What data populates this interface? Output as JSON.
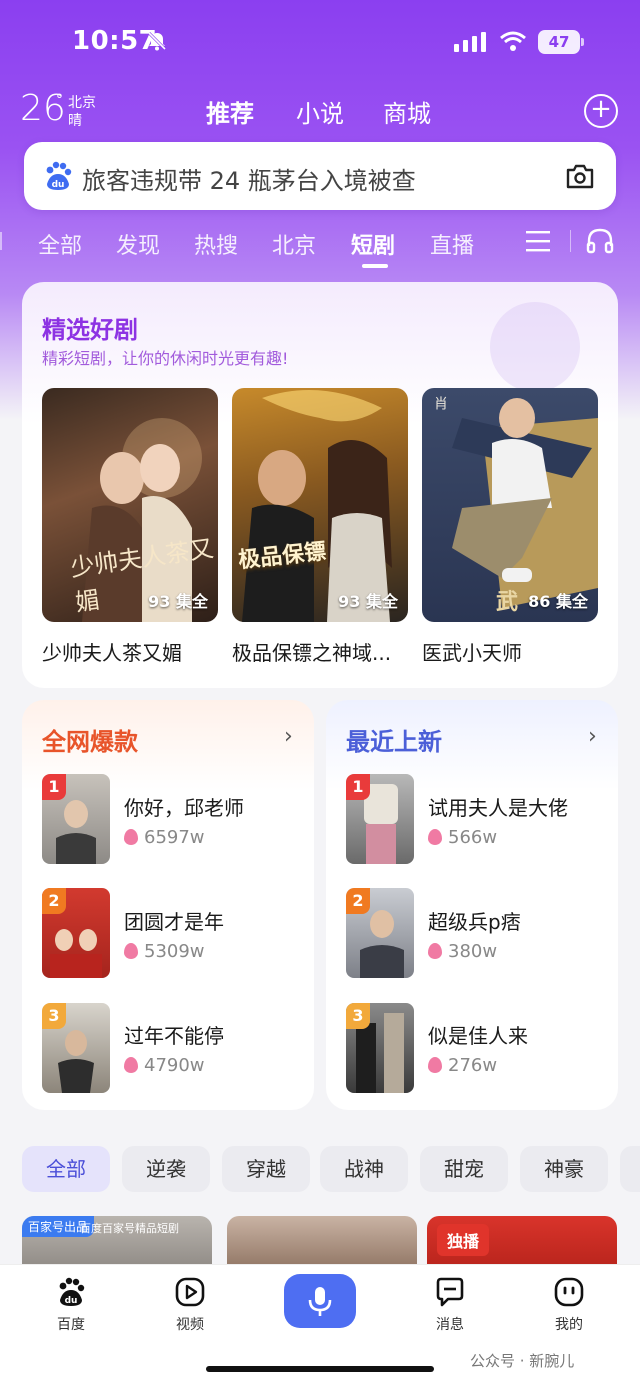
{
  "status_bar": {
    "time": "10:57",
    "battery": "47"
  },
  "weather": {
    "temp": "26",
    "degree": "°",
    "city": "北京",
    "condition": "晴"
  },
  "top_tabs": [
    "推荐",
    "小说",
    "商城"
  ],
  "search": {
    "query": "旅客违规带 24 瓶茅台入境被查"
  },
  "channel_tabs": [
    "全部",
    "发现",
    "热搜",
    "北京",
    "短剧",
    "直播"
  ],
  "featured": {
    "title": "精选好剧",
    "subtitle": "精彩短剧，让你的休闲时光更有趣!",
    "items": [
      {
        "title": "少帅夫人茶又媚",
        "episodes": "93 集全",
        "poster_text": "少帅夫人茶又媚"
      },
      {
        "title": "极品保镖之神域...",
        "episodes": "93 集全",
        "poster_text": "极品保镖"
      },
      {
        "title": "医武小天师",
        "episodes": "86 集全",
        "poster_text": "武"
      }
    ]
  },
  "ranking_hot": {
    "title": "全网爆款",
    "items": [
      {
        "rank": "1",
        "name": "你好，邱老师",
        "heat": "6597w"
      },
      {
        "rank": "2",
        "name": "团圆才是年",
        "heat": "5309w"
      },
      {
        "rank": "3",
        "name": "过年不能停",
        "heat": "4790w"
      }
    ]
  },
  "ranking_new": {
    "title": "最近上新",
    "items": [
      {
        "rank": "1",
        "name": "试用夫人是大佬",
        "heat": "566w"
      },
      {
        "rank": "2",
        "name": "超级兵p痞",
        "heat": "380w"
      },
      {
        "rank": "3",
        "name": "似是佳人来",
        "heat": "276w"
      }
    ]
  },
  "genres": [
    "全部",
    "逆袭",
    "穿越",
    "战神",
    "甜宠",
    "神豪"
  ],
  "peek_cards": {
    "tag1": "百家号出品",
    "tag1_sub": "百度百家号精品短剧",
    "tag3": "独播"
  },
  "bottom_nav": [
    "百度",
    "视频",
    "消息",
    "我的"
  ],
  "watermark": "公众号 · 新腕儿",
  "colors": {
    "accent": "#8b3ff0",
    "hot": "#e8542a",
    "new": "#4b5fd8",
    "rank1": "#e93b3b",
    "rank2": "#f07a21",
    "rank3": "#f2a93b"
  }
}
